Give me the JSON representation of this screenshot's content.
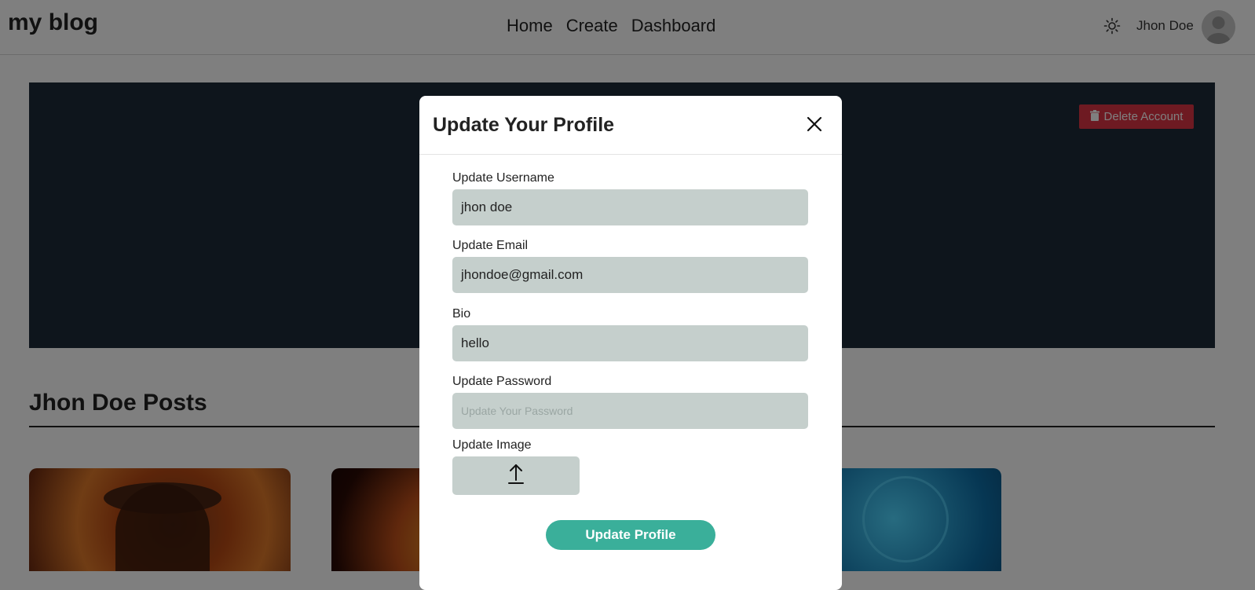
{
  "navbar": {
    "brand": "my blog",
    "links": [
      "Home",
      "Create",
      "Dashboard"
    ],
    "theme_icon": "sun-icon",
    "user_name": "Jhon Doe",
    "avatar_icon": "user-avatar-icon"
  },
  "profile": {
    "delete_label": "Delete Account",
    "delete_icon": "trash-icon",
    "delete_color": "#dc3545"
  },
  "posts": {
    "title": "Jhon Doe Posts"
  },
  "modal": {
    "title": "Update Your Profile",
    "close_icon": "close-icon",
    "username_label": "Update Username",
    "username_value": "jhon doe",
    "email_label": "Update Email",
    "email_value": "jhondoe@gmail.com",
    "bio_label": "Bio",
    "bio_value": "hello",
    "password_label": "Update Password",
    "password_placeholder": "Update Your Password",
    "image_label": "Update Image",
    "upload_icon": "upload-icon",
    "submit_label": "Update Profile",
    "submit_color": "#3aaf9a"
  }
}
